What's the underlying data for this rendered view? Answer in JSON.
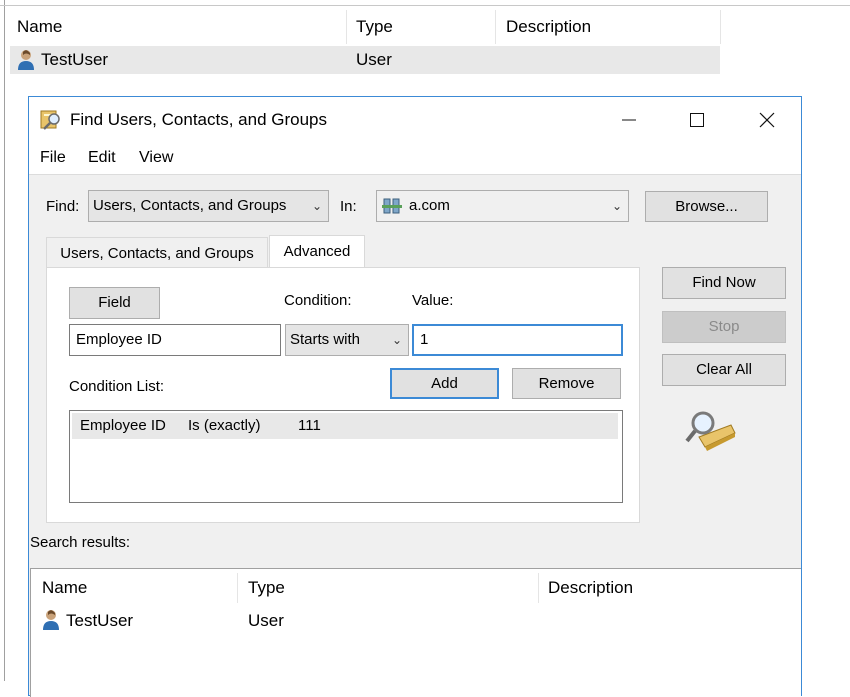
{
  "background_list": {
    "columns": [
      "Name",
      "Type",
      "Description"
    ],
    "rows": [
      {
        "name": "TestUser",
        "type": "User",
        "description": ""
      }
    ]
  },
  "dialog": {
    "title": "Find Users, Contacts, and Groups",
    "menu": [
      "File",
      "Edit",
      "View"
    ],
    "find_label": "Find:",
    "find_value": "Users, Contacts, and Groups",
    "in_label": "In:",
    "in_value": "a.com",
    "browse_label": "Browse...",
    "tabs": [
      "Users, Contacts, and Groups",
      "Advanced"
    ],
    "field_button": "Field",
    "condition_label": "Condition:",
    "value_label": "Value:",
    "field_value": "Employee ID",
    "condition_value": "Starts with",
    "value_input": "1",
    "condition_list_label": "Condition List:",
    "add_label": "Add",
    "remove_label": "Remove",
    "condition_list": [
      {
        "field": "Employee ID",
        "op": "Is (exactly)",
        "value": "111"
      }
    ],
    "find_now_label": "Find Now",
    "stop_label": "Stop",
    "clear_all_label": "Clear All",
    "search_results_label": "Search results:",
    "results_columns": [
      "Name",
      "Type",
      "Description"
    ],
    "results": [
      {
        "name": "TestUser",
        "type": "User",
        "description": ""
      }
    ]
  },
  "colors": {
    "accent": "#3c8ad6",
    "window_bg": "#f0f0f0",
    "selection_gray": "#e8e8e8"
  },
  "icons": [
    "user-icon",
    "find-dialog-icon",
    "minimize-icon",
    "maximize-icon",
    "close-icon",
    "chevron-down-icon",
    "domain-icon",
    "search-magnifier-icon"
  ]
}
